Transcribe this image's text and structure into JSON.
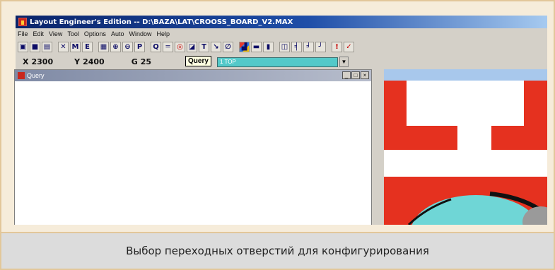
{
  "window": {
    "title": "Layout Engineer's Edition -- D:\\BAZA\\LAT\\CROOSS_BOARD_V2.MAX"
  },
  "menu": [
    "File",
    "Edit",
    "View",
    "Tool",
    "Options",
    "Auto",
    "Window",
    "Help"
  ],
  "toolbar": {
    "buttons": [
      {
        "icon": "open-icon",
        "glyph": "▣"
      },
      {
        "icon": "save-icon",
        "glyph": "■"
      },
      {
        "icon": "print-icon",
        "glyph": "▤"
      },
      {
        "icon": "cut-icon",
        "glyph": "✕"
      },
      {
        "icon": "binoculars-icon",
        "glyph": "M"
      },
      {
        "icon": "edit-icon",
        "glyph": "E"
      },
      {
        "icon": "grid-icon",
        "glyph": "▦"
      },
      {
        "icon": "zoom-in-icon",
        "glyph": "⊕"
      },
      {
        "icon": "zoom-out-icon",
        "glyph": "⊖"
      },
      {
        "icon": "zoom-icon",
        "glyph": "P"
      },
      {
        "icon": "query-icon",
        "glyph": "Q"
      },
      {
        "icon": "line-icon",
        "glyph": "═"
      },
      {
        "icon": "via-icon",
        "glyph": "◎"
      },
      {
        "icon": "copper-icon",
        "glyph": "◪"
      },
      {
        "icon": "text-icon",
        "glyph": "T"
      },
      {
        "icon": "route-icon",
        "glyph": "↘"
      },
      {
        "icon": "circle-icon",
        "glyph": "∅"
      },
      {
        "icon": "colors-icon",
        "glyph": "▟"
      },
      {
        "icon": "drc-icon",
        "glyph": "▬"
      },
      {
        "icon": "bus-icon",
        "glyph": "▮"
      },
      {
        "icon": "component-icon",
        "glyph": "◫"
      },
      {
        "icon": "pin-icon",
        "glyph": "╡"
      },
      {
        "icon": "fanout-icon",
        "glyph": "╛"
      },
      {
        "icon": "trace-icon",
        "glyph": "╯"
      },
      {
        "icon": "warning-icon",
        "glyph": "!"
      },
      {
        "icon": "check-icon",
        "glyph": "✓"
      }
    ]
  },
  "coords": {
    "x_label": "X",
    "x_value": "2300",
    "y_label": "Y",
    "y_value": "2400",
    "g_label": "G",
    "g_value": "25"
  },
  "tooltip": "Query",
  "layer_select": {
    "value": "1 TOP"
  },
  "query_window": {
    "title": "Query",
    "minimize": "_",
    "maximize": "□",
    "close": "×"
  },
  "caption": "Выбор переходных отверстий для конфигурирования",
  "colors": {
    "titlebar": "#0a246a",
    "board_red": "#e5311f",
    "board_cyan": "#6fd6d6",
    "layer_select": "#53c9c9"
  }
}
